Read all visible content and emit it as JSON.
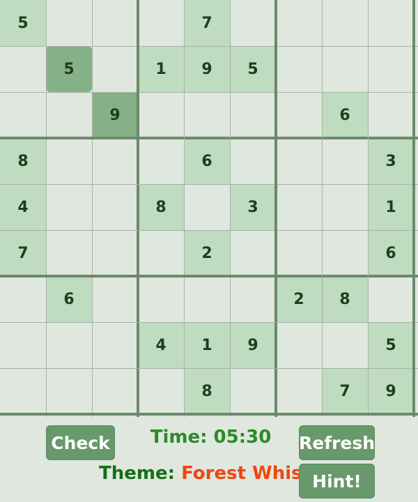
{
  "board": {
    "grid": [
      [
        "5",
        "",
        "",
        "",
        "7",
        "",
        "",
        "",
        ""
      ],
      [
        "",
        "5",
        "",
        "1",
        "9",
        "5",
        "",
        "",
        ""
      ],
      [
        "",
        "",
        "9",
        "",
        "",
        "",
        "",
        "6",
        ""
      ],
      [
        "8",
        "",
        "",
        "",
        "6",
        "",
        "",
        "",
        "3"
      ],
      [
        "4",
        "",
        "",
        "8",
        "",
        "3",
        "",
        "",
        "1"
      ],
      [
        "7",
        "",
        "",
        "",
        "2",
        "",
        "",
        "",
        "6"
      ],
      [
        "",
        "6",
        "",
        "",
        "",
        "",
        "2",
        "8",
        ""
      ],
      [
        "",
        "",
        "",
        "4",
        "1",
        "9",
        "",
        "",
        "5"
      ],
      [
        "",
        "",
        "",
        "",
        "8",
        "",
        "",
        "7",
        "9"
      ]
    ],
    "selected": {
      "row": 1,
      "col": 1
    },
    "same_value_highlight": {
      "row": 2,
      "col": 2
    },
    "colors": {
      "empty": "#dfe7df",
      "given": "#c0dcc0",
      "selected": "#86b186",
      "thin_line": "#a3b3a3",
      "thick_line": "#6b8a6b",
      "digit": "#1f3d1f"
    }
  },
  "controls": {
    "check_label": "Check",
    "refresh_label": "Refresh",
    "hint_label": "Hint!",
    "timer_text": "Time: 05:30",
    "theme_label": "Theme:",
    "theme_value": "Forest Whisper"
  }
}
